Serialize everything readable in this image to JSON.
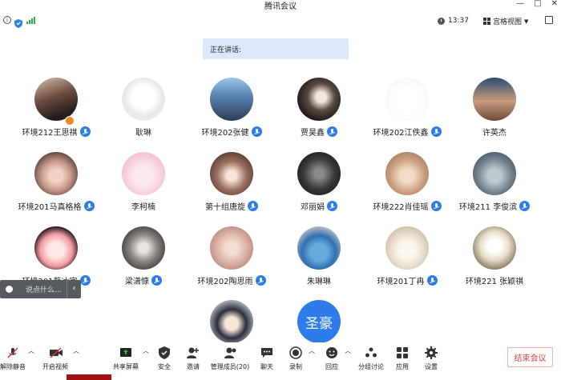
{
  "window": {
    "title": "腾讯会议",
    "controls": [
      "—",
      "□",
      "✕"
    ]
  },
  "status": {
    "time": "13:37",
    "view_label": "宫格视图"
  },
  "speaking": "正在讲话:",
  "participants": [
    {
      "name": "环境212王思祺",
      "mic": true,
      "style": "photo-girl",
      "muted_badge": true
    },
    {
      "name": "耿琳",
      "mic": false,
      "style": "sketch"
    },
    {
      "name": "环境202张健",
      "mic": true,
      "style": "sea"
    },
    {
      "name": "贾昊鑫",
      "mic": true,
      "style": "dark-portrait"
    },
    {
      "name": "环境202江佚鑫",
      "mic": true,
      "style": "cartoon-glasses"
    },
    {
      "name": "许英杰",
      "mic": false,
      "style": "boy"
    },
    {
      "name": "环境201马真格格",
      "mic": true,
      "style": "girl-hand"
    },
    {
      "name": "李柯楠",
      "mic": false,
      "style": "pink-rabbit"
    },
    {
      "name": "第十组唐旋",
      "mic": true,
      "style": "soft-girl"
    },
    {
      "name": "邓丽娟",
      "mic": true,
      "style": "bw-group"
    },
    {
      "name": "环境222肖佳瑶",
      "mic": true,
      "style": "cat"
    },
    {
      "name": "环境211 李俊滨",
      "mic": true,
      "style": "tom-cat"
    },
    {
      "name": "环境201蔡冰宇",
      "mic": true,
      "style": "cartoon-red"
    },
    {
      "name": "梁潇慷",
      "mic": true,
      "style": "mirror-girl"
    },
    {
      "name": "环境202陶思雨",
      "mic": true,
      "style": "blur-girl"
    },
    {
      "name": "朱琳琳",
      "mic": false,
      "style": "blue-cat"
    },
    {
      "name": "环境201丁冉",
      "mic": true,
      "style": "white-cat"
    },
    {
      "name": "环境221 张颖祺",
      "mic": false,
      "style": "ice-cream"
    },
    {
      "name": "",
      "mic": false,
      "style": "anime-boy"
    },
    {
      "name": "",
      "mic": false,
      "style": "text",
      "avatar_text": "圣豪"
    }
  ],
  "chat_popup": {
    "text": "说点什么..."
  },
  "toolbar": {
    "unmute": "解除静音",
    "start_video": "开启视频",
    "share_screen": "共享屏幕",
    "security": "安全",
    "invite": "邀请",
    "members": "管理成员(20)",
    "chat": "聊天",
    "record": "录制",
    "reactions": "回应",
    "breakout": "分组讨论",
    "apps": "应用",
    "settings": "设置",
    "end": "结束会议"
  },
  "colors": {
    "accent": "#2e7bea",
    "speaking_bg": "#dce9fb",
    "end_red": "#d64545"
  }
}
